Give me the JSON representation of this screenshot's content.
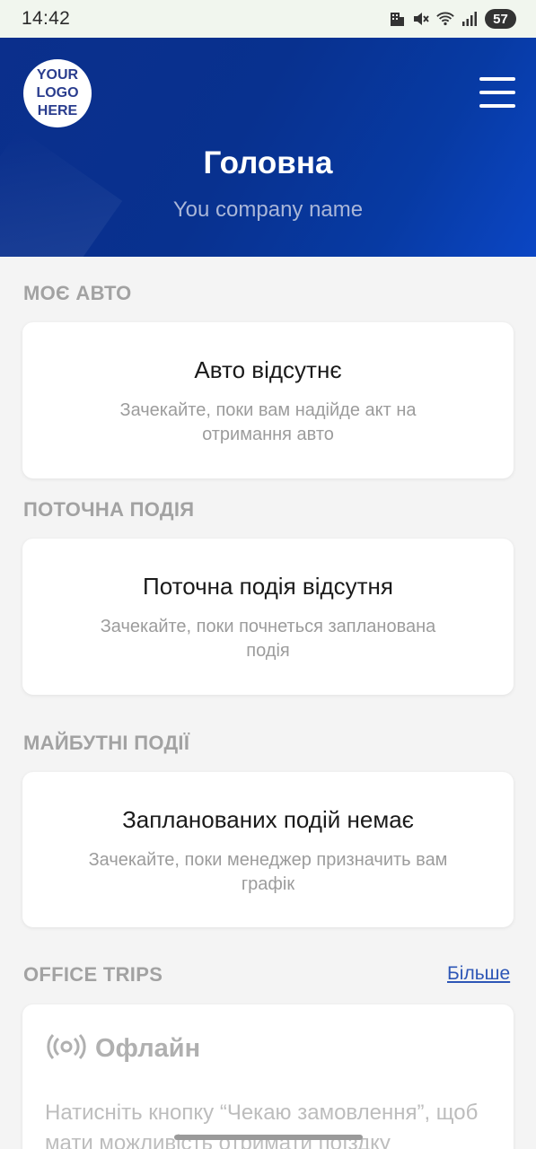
{
  "status_bar": {
    "time": "14:42",
    "battery": "57"
  },
  "header": {
    "logo_lines": [
      "YOUR",
      "LOGO",
      "HERE"
    ],
    "title": "Головна",
    "company": "You company name"
  },
  "sections": {
    "car": {
      "title": "МОЄ АВТО",
      "card_title": "Авто відсутнє",
      "card_sub": "Зачекайте, поки вам надійде акт на отримання авто"
    },
    "current_event": {
      "title": "ПОТОЧНА ПОДІЯ",
      "card_title": "Поточна подія відсутня",
      "card_sub": "Зачекайте, поки почнеться запланована подія"
    },
    "future_events": {
      "title": "МАЙБУТНІ ПОДІЇ",
      "card_title": "Запланованих подій немає",
      "card_sub": "Зачекайте, поки менеджер призначить вам графік"
    },
    "office_trips": {
      "title": "OFFICE TRIPS",
      "more_label": "Більше",
      "status": "Офлайн",
      "text": "Натисніть кнопку “Чекаю замовлення”, щоб мати можливість отримати поїздку"
    }
  },
  "icons": {
    "menu": "hamburger-icon",
    "offline": "broadcast-icon"
  },
  "colors": {
    "header_bg": "#08318f",
    "link": "#2d56b6"
  }
}
